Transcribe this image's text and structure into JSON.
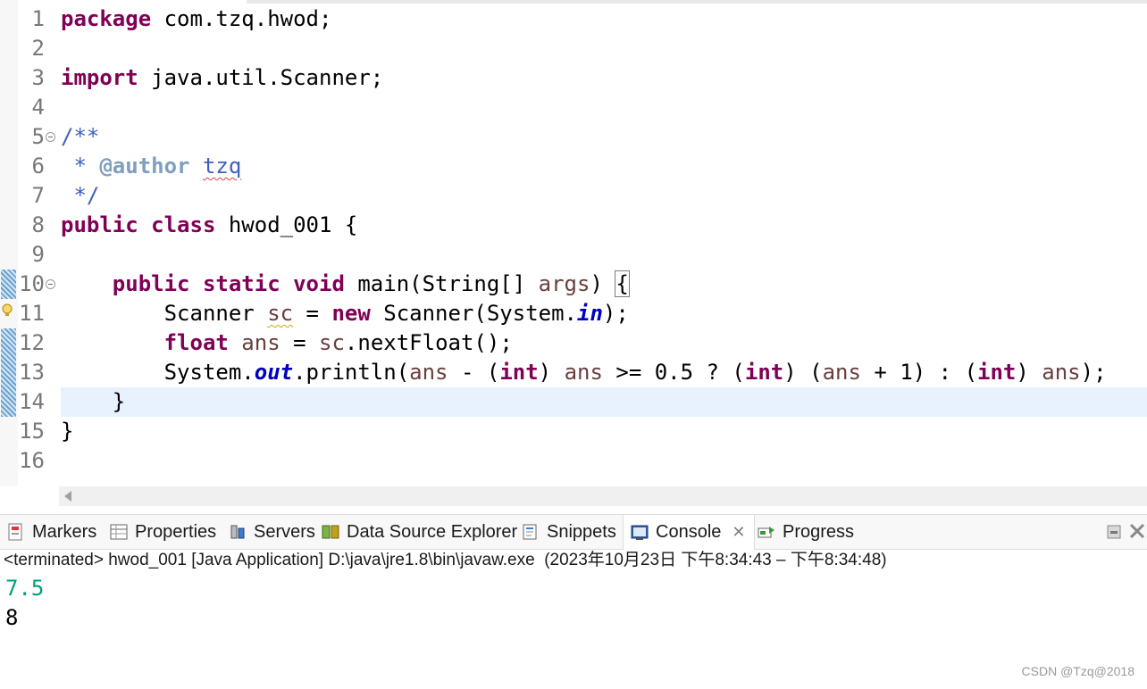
{
  "editor": {
    "line_numbers": [
      "1",
      "2",
      "3",
      "4",
      "5",
      "6",
      "7",
      "8",
      "9",
      "10",
      "11",
      "12",
      "13",
      "14",
      "15",
      "16"
    ],
    "code": {
      "l1": [
        "package",
        " com.tzq.hwod;"
      ],
      "l3": [
        "import",
        " java.util.Scanner;"
      ],
      "l5": "/**",
      "l6": [
        " * ",
        "@author",
        " ",
        "tzq"
      ],
      "l7": " */",
      "l8": [
        "public",
        " ",
        "class",
        " hwod_001 {"
      ],
      "l10": [
        "    ",
        "public",
        " ",
        "static",
        " ",
        "void",
        " main(String[] ",
        "args",
        ") ",
        "{"
      ],
      "l11": [
        "        Scanner ",
        "sc",
        " = ",
        "new",
        " Scanner(System.",
        "in",
        ");"
      ],
      "l12": [
        "        ",
        "float",
        " ",
        "ans",
        " = ",
        "sc",
        ".nextFloat();"
      ],
      "l13": [
        "        System.",
        "out",
        ".println(",
        "ans",
        " - (",
        "int",
        ") ",
        "ans",
        " >= 0.5 ? (",
        "int",
        ") (",
        "ans",
        " + 1) : (",
        "int",
        ") ",
        "ans",
        ");"
      ],
      "l14": "    }",
      "l15": "}"
    }
  },
  "views": {
    "tabs": [
      {
        "label": "Markers",
        "icon": "markers-icon"
      },
      {
        "label": "Properties",
        "icon": "properties-icon"
      },
      {
        "label": "Servers",
        "icon": "servers-icon"
      },
      {
        "label": "Data Source Explorer",
        "icon": "data-source-explorer-icon"
      },
      {
        "label": "Snippets",
        "icon": "snippets-icon"
      },
      {
        "label": "Console",
        "icon": "console-icon",
        "active": true,
        "close": "✕"
      },
      {
        "label": "Progress",
        "icon": "progress-icon"
      }
    ]
  },
  "console": {
    "header": "<terminated> hwod_001 [Java Application] D:\\java\\jre1.8\\bin\\javaw.exe  (2023年10月23日 下午8:34:43 – 下午8:34:48)",
    "input_line": "7.5",
    "output_line": "8"
  },
  "watermark": "CSDN @Tzq@2018",
  "colors": {
    "keyword": "#7f0055",
    "comment": "#3f5fbf",
    "javadoc_tag": "#7f9fbf",
    "static_field": "#0000c0",
    "local_var": "#6a3e3e",
    "console_input": "#00a07a",
    "current_line": "#e8f2fe"
  }
}
